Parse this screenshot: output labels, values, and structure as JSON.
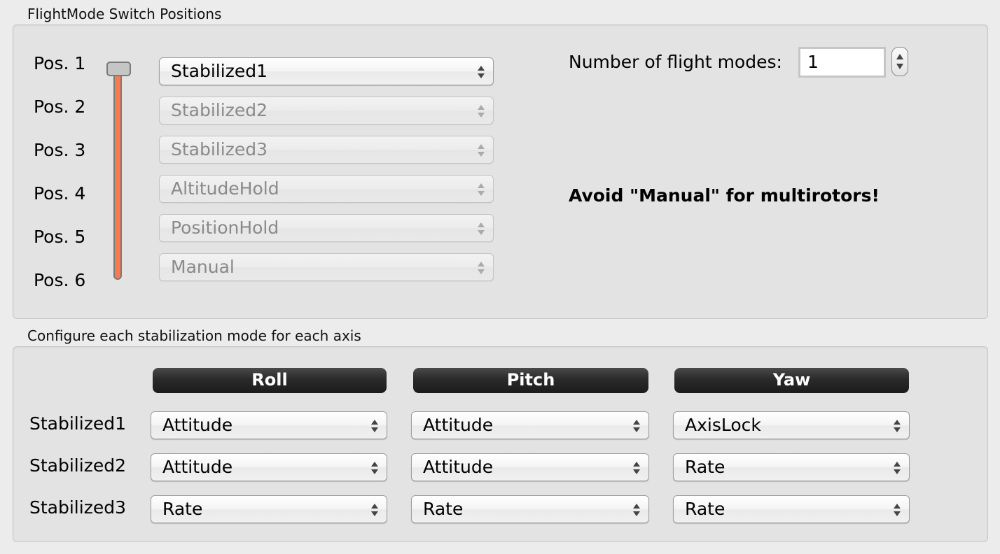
{
  "flightmode_group": {
    "title": "FlightMode Switch Positions",
    "positions": [
      {
        "label": "Pos. 1",
        "mode": "Stabilized1",
        "enabled": true
      },
      {
        "label": "Pos. 2",
        "mode": "Stabilized2",
        "enabled": false
      },
      {
        "label": "Pos. 3",
        "mode": "Stabilized3",
        "enabled": false
      },
      {
        "label": "Pos. 4",
        "mode": "AltitudeHold",
        "enabled": false
      },
      {
        "label": "Pos. 5",
        "mode": "PositionHold",
        "enabled": false
      },
      {
        "label": "Pos. 6",
        "mode": "Manual",
        "enabled": false
      }
    ],
    "switch_position": 1,
    "num_modes_label": "Number of flight modes:",
    "num_modes_value": "1",
    "warning": "Avoid \"Manual\" for multirotors!",
    "slider_color": "#f77b4e"
  },
  "stabilization_group": {
    "title": "Configure each stabilization mode for each axis",
    "axes": [
      "Roll",
      "Pitch",
      "Yaw"
    ],
    "rows": [
      {
        "label": "Stabilized1",
        "values": [
          "Attitude",
          "Attitude",
          "AxisLock"
        ]
      },
      {
        "label": "Stabilized2",
        "values": [
          "Attitude",
          "Attitude",
          "Rate"
        ]
      },
      {
        "label": "Stabilized3",
        "values": [
          "Rate",
          "Rate",
          "Rate"
        ]
      }
    ]
  }
}
